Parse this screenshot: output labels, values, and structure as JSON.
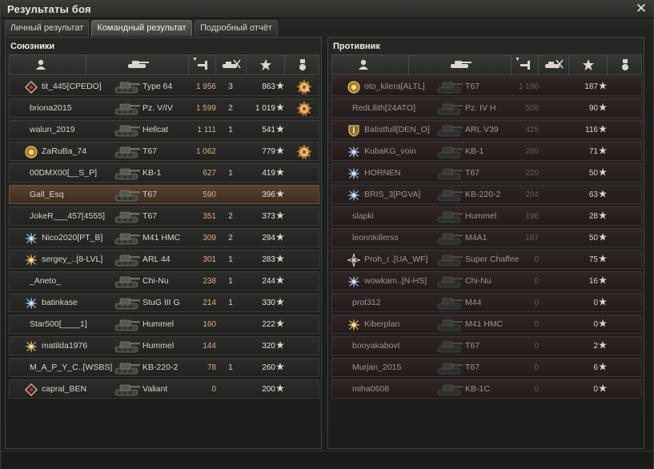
{
  "window": {
    "title": "Результаты боя",
    "close_label": "✕"
  },
  "tabs": [
    {
      "label": "Личный результат",
      "active": false
    },
    {
      "label": "Командный результат",
      "active": true
    },
    {
      "label": "Подробный отчёт",
      "active": false
    }
  ],
  "allies": {
    "title": "Союзники",
    "columns": [
      "player-icon",
      "tank-icon",
      "damage-icon",
      "kills-icon",
      "xp-star-icon",
      "medal-icon"
    ],
    "rows": [
      {
        "badge": "diamond",
        "name": "tit_445[CPEDO]",
        "tank": "Type 64",
        "damage": "1 956",
        "kills": "3",
        "xp": "863",
        "medal": "yes",
        "medal_count": "3",
        "player": false
      },
      {
        "badge": "",
        "name": "briona2015",
        "tank": "Pz. V/IV",
        "damage": "1 599",
        "kills": "2",
        "xp": "1 019",
        "medal": "yes",
        "medal_count": "",
        "player": false
      },
      {
        "badge": "",
        "name": "walun_2019",
        "tank": "Hellcat",
        "damage": "1 111",
        "kills": "1",
        "xp": "541",
        "medal": "",
        "medal_count": "",
        "player": false
      },
      {
        "badge": "gold-circle",
        "name": "ZaRuBa_74",
        "tank": "T67",
        "damage": "1 062",
        "kills": "",
        "xp": "779",
        "medal": "yes",
        "medal_count": "",
        "player": false
      },
      {
        "badge": "",
        "name": "00DMX00[__S_P]",
        "tank": "KB-1",
        "damage": "627",
        "kills": "1",
        "xp": "419",
        "medal": "",
        "medal_count": "",
        "player": false
      },
      {
        "badge": "",
        "name": "Gall_Esq",
        "tank": "T67",
        "damage": "590",
        "kills": "",
        "xp": "396",
        "medal": "",
        "medal_count": "",
        "player": true
      },
      {
        "badge": "",
        "name": "JokeR___457[4555]",
        "tank": "T67",
        "damage": "351",
        "kills": "2",
        "xp": "373",
        "medal": "",
        "medal_count": "",
        "player": false
      },
      {
        "badge": "blue-star",
        "name": "Nico2020[PT_B]",
        "tank": "M41 HMC",
        "damage": "309",
        "kills": "2",
        "xp": "294",
        "medal": "",
        "medal_count": "",
        "player": false
      },
      {
        "badge": "gold-star",
        "name": "sergey_..[8-LVL]",
        "tank": "ARL 44",
        "damage": "301",
        "kills": "1",
        "xp": "283",
        "medal": "",
        "medal_count": "",
        "player": false
      },
      {
        "badge": "",
        "name": "_Aneto_",
        "tank": "Chi-Nu",
        "damage": "238",
        "kills": "1",
        "xp": "244",
        "medal": "",
        "medal_count": "",
        "player": false
      },
      {
        "badge": "blue-star",
        "name": "batinkase",
        "tank": "StuG III G",
        "damage": "214",
        "kills": "1",
        "xp": "330",
        "medal": "",
        "medal_count": "",
        "player": false
      },
      {
        "badge": "",
        "name": "Star500[____1]",
        "tank": "Hummel",
        "damage": "160",
        "kills": "",
        "xp": "222",
        "medal": "",
        "medal_count": "",
        "player": false
      },
      {
        "badge": "gold-star",
        "name": "matilda1976",
        "tank": "Hummel",
        "damage": "144",
        "kills": "",
        "xp": "320",
        "medal": "",
        "medal_count": "",
        "player": false
      },
      {
        "badge": "",
        "name": "M_A_P_Y_C..[WSBS]",
        "tank": "KB-220-2",
        "damage": "78",
        "kills": "1",
        "xp": "260",
        "medal": "",
        "medal_count": "",
        "player": false
      },
      {
        "badge": "diamond",
        "name": "capral_BEN",
        "tank": "Valiant",
        "damage": "0",
        "kills": "",
        "xp": "200",
        "medal": "",
        "medal_count": "",
        "player": false
      }
    ]
  },
  "enemies": {
    "title": "Противник",
    "rows": [
      {
        "badge": "gold-circle",
        "name": "oto_kilera[ALTL]",
        "tank": "T67",
        "damage": "1 186",
        "kills": "",
        "xp": "187"
      },
      {
        "badge": "",
        "name": "RedLilith[24ATO]",
        "tank": "Pz. IV H",
        "damage": "508",
        "kills": "",
        "xp": "90"
      },
      {
        "badge": "shield",
        "name": "Batistfull[DEN_O]",
        "tank": "ARL V39",
        "damage": "425",
        "kills": "",
        "xp": "116"
      },
      {
        "badge": "blue-star",
        "name": "KubaKG_voin",
        "tank": "KB-1",
        "damage": "280",
        "kills": "",
        "xp": "71"
      },
      {
        "badge": "blue-star",
        "name": "HORNEN",
        "tank": "T67",
        "damage": "220",
        "kills": "",
        "xp": "50"
      },
      {
        "badge": "blue-star",
        "name": "BRIS_3[PGVA]",
        "tank": "KB-220-2",
        "damage": "204",
        "kills": "",
        "xp": "63"
      },
      {
        "badge": "",
        "name": "slapki",
        "tank": "Hummel",
        "damage": "196",
        "kills": "",
        "xp": "28"
      },
      {
        "badge": "",
        "name": "leonnkillerss",
        "tank": "M4A1",
        "damage": "187",
        "kills": "",
        "xp": "50"
      },
      {
        "badge": "white-star",
        "name": "Proh_r..[UA_WF]",
        "tank": "Super Chaffee",
        "damage": "0",
        "kills": "",
        "xp": "75"
      },
      {
        "badge": "blue-star",
        "name": "wowkam..[N-HS]",
        "tank": "Chi-Nu",
        "damage": "0",
        "kills": "",
        "xp": "16"
      },
      {
        "badge": "",
        "name": "prot312",
        "tank": "M44",
        "damage": "0",
        "kills": "",
        "xp": "0"
      },
      {
        "badge": "gold-star",
        "name": "Kiberplan",
        "tank": "M41 HMC",
        "damage": "0",
        "kills": "",
        "xp": "0"
      },
      {
        "badge": "",
        "name": "booyakabovt",
        "tank": "T67",
        "damage": "0",
        "kills": "",
        "xp": "2"
      },
      {
        "badge": "",
        "name": "Murjan_2015",
        "tank": "T67",
        "damage": "0",
        "kills": "",
        "xp": "6"
      },
      {
        "badge": "",
        "name": "miha0608",
        "tank": "KB-1C",
        "damage": "0",
        "kills": "",
        "xp": "0"
      }
    ]
  },
  "colors": {
    "damage_ally": "#d9b07e",
    "player_row": "#5a4230",
    "enemy_row": "#302424"
  }
}
